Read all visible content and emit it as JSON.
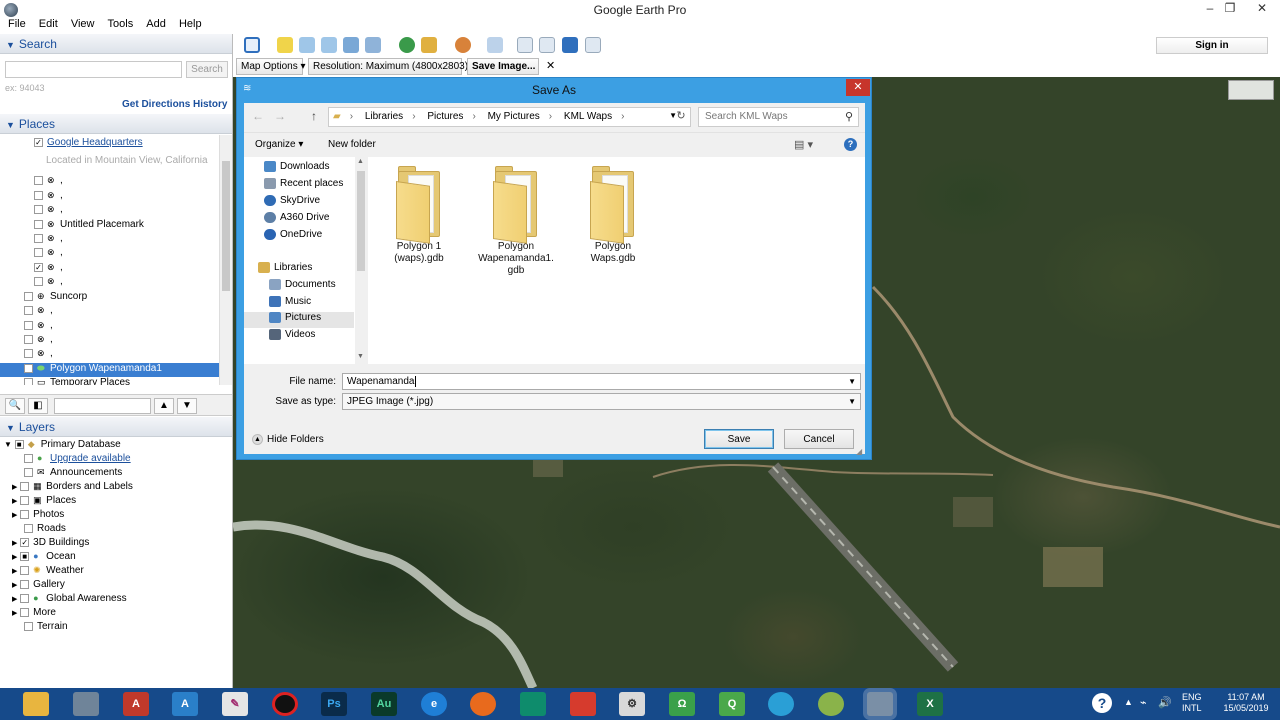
{
  "window": {
    "title": "Google Earth Pro",
    "minimize": "–",
    "restore": "❐",
    "close": "✕"
  },
  "menu": [
    "File",
    "Edit",
    "View",
    "Tools",
    "Add",
    "Help"
  ],
  "search": {
    "header": "Search",
    "placeholder": "",
    "button": "Search",
    "hint": "ex: 94043",
    "get_directions": "Get Directions",
    "history": "History"
  },
  "places": {
    "header": "Places",
    "items": [
      {
        "label": "Google Headquarters",
        "checked": true,
        "link": true
      },
      {
        "label": "Located in Mountain View, California",
        "sub": true
      },
      {
        "label": ",",
        "checked": false
      },
      {
        "label": ",",
        "checked": false
      },
      {
        "label": ",",
        "checked": false
      },
      {
        "label": "Untitled Placemark",
        "checked": false
      },
      {
        "label": ",",
        "checked": false
      },
      {
        "label": ",",
        "checked": false
      },
      {
        "label": ",",
        "checked": true
      },
      {
        "label": ",",
        "checked": false
      },
      {
        "label": "Suncorp",
        "checked": false
      },
      {
        "label": ",",
        "checked": false
      },
      {
        "label": ",",
        "checked": false
      },
      {
        "label": ",",
        "checked": false
      },
      {
        "label": ",",
        "checked": false
      },
      {
        "label": "Polygon Wapenamanda1",
        "checked": false,
        "selected": true
      },
      {
        "label": "Temporary Places",
        "checked": false
      }
    ]
  },
  "layers": {
    "header": "Layers",
    "items": [
      {
        "label": "Primary Database",
        "checked": "partial"
      },
      {
        "label": "Upgrade available",
        "link": true
      },
      {
        "label": "Announcements"
      },
      {
        "label": "Borders and Labels"
      },
      {
        "label": "Places"
      },
      {
        "label": "Photos"
      },
      {
        "label": "Roads"
      },
      {
        "label": "3D Buildings",
        "checked": true
      },
      {
        "label": "Ocean",
        "checked": "partial"
      },
      {
        "label": "Weather"
      },
      {
        "label": "Gallery"
      },
      {
        "label": "Global Awareness"
      },
      {
        "label": "More"
      },
      {
        "label": "Terrain"
      }
    ]
  },
  "options": {
    "map_options": "Map Options",
    "resolution": "Resolution: Maximum (4800x2803)",
    "save_image": "Save Image...",
    "close": "✕"
  },
  "signin": "Sign in",
  "dialog": {
    "title": "Save As",
    "close": "✕",
    "breadcrumbs": [
      "Libraries",
      "Pictures",
      "My Pictures",
      "KML Waps"
    ],
    "search_placeholder": "Search KML Waps",
    "organize": "Organize ▾",
    "new_folder": "New folder",
    "nav": [
      {
        "label": "Downloads",
        "color": "#4a88c7"
      },
      {
        "label": "Recent places",
        "color": "#8a9aae"
      },
      {
        "label": "SkyDrive",
        "color": "#2f6bb4"
      },
      {
        "label": "A360 Drive",
        "color": "#5d7fa6"
      },
      {
        "label": "OneDrive",
        "color": "#2a64b2"
      },
      {
        "label": "Libraries",
        "color": "#d8b04f"
      },
      {
        "label": "Documents",
        "color": "#8aa3c2"
      },
      {
        "label": "Music",
        "color": "#3e73b8"
      },
      {
        "label": "Pictures",
        "color": "#4f86c4",
        "selected": true
      },
      {
        "label": "Videos",
        "color": "#55657a"
      }
    ],
    "folders": [
      {
        "line1": "Polygon 1",
        "line2": "(waps).gdb",
        "line3": ""
      },
      {
        "line1": "Polygon",
        "line2": "Wapenamanda1.",
        "line3": "gdb"
      },
      {
        "line1": "Polygon",
        "line2": "Waps.gdb",
        "line3": ""
      }
    ],
    "file_name_label": "File name:",
    "file_name_value": "Wapenamanda",
    "save_type_label": "Save as type:",
    "save_type_value": "JPEG Image (*.jpg)",
    "hide_folders": "Hide Folders",
    "save": "Save",
    "cancel": "Cancel"
  },
  "taskbar": {
    "lang_top": "ENG",
    "lang_bottom": "INTL",
    "time": "11:07 AM",
    "date": "15/05/2019"
  },
  "colors": {
    "accent": "#3c9fe3",
    "selection": "#3a7ed1",
    "taskbar": "#164a8a",
    "link": "#1b4f9c"
  }
}
